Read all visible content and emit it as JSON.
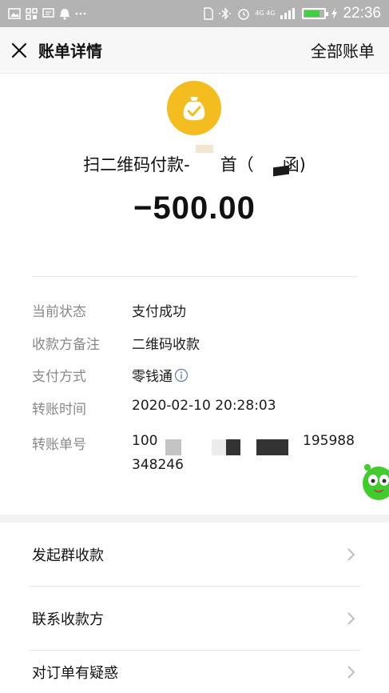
{
  "status_bar": {
    "network_label": "4G 4G",
    "time": "22:36",
    "battery_level": 0.8,
    "icons": [
      "image-icon",
      "grid-icon",
      "message-icon",
      "notification-icon",
      "more-icon",
      "nfc-icon",
      "bluetooth-icon",
      "alarm-icon",
      "signal-icon",
      "battery-icon",
      "charging-icon"
    ]
  },
  "nav": {
    "title": "账单详情",
    "right_action": "全部账单",
    "close_icon": "close-icon"
  },
  "header": {
    "merchant_icon": "money-bag-icon",
    "merchant_icon_color": "#f4bd1f",
    "title_prefix": "扫二维码付款-",
    "title_partial": "首（",
    "title_suffix": "函)",
    "amount": "−500.00"
  },
  "details": [
    {
      "label": "当前状态",
      "value": "支付成功"
    },
    {
      "label": "收款方备注",
      "value": "二维码收款"
    },
    {
      "label": "支付方式",
      "value": "零钱通"
    },
    {
      "label": "转账时间",
      "value": "2020-02-10 20:28:03"
    }
  ],
  "transaction": {
    "label": "转账单号",
    "prefix": "100",
    "suffix": "195988",
    "line2": "348246"
  },
  "actions": [
    {
      "label": "发起群收款"
    },
    {
      "label": "联系收款方"
    },
    {
      "label": "对订单有疑惑"
    }
  ]
}
